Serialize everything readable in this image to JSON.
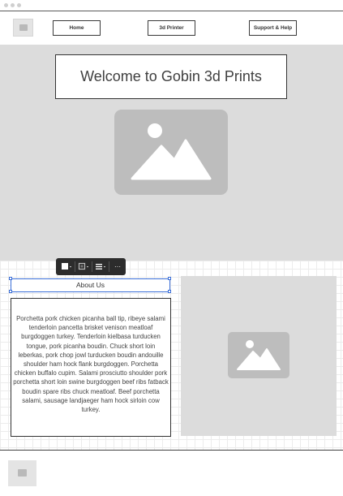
{
  "nav": {
    "items": [
      {
        "label": "Home"
      },
      {
        "label": "3d Printer"
      },
      {
        "label": "Support & Help"
      }
    ]
  },
  "hero": {
    "title": "Welcome to Gobin 3d Prints"
  },
  "toolbar": {
    "more_label": "···"
  },
  "about": {
    "heading": "About Us",
    "body": "Porchetta pork chicken picanha ball tip, ribeye salami tenderloin pancetta brisket venison meatloaf burgdoggen turkey. Tenderloin kielbasa turducken tongue, pork picanha boudin. Chuck short loin leberkas, pork chop jowl turducken boudin andouille shoulder ham hock flank burgdoggen. Porchetta chicken buffalo cupim. Salami prosciutto shoulder pork porchetta short loin swine burgdoggen beef ribs fatback boudin spare ribs chuck meatloaf. Beef porchetta salami, sausage landjaeger ham hock sirloin cow turkey."
  },
  "icons": {
    "logo": "image-placeholder-icon",
    "hero_image": "image-placeholder-icon",
    "side_image": "image-placeholder-icon",
    "footer_logo": "image-placeholder-icon"
  },
  "colors": {
    "selection": "#3b6fd8",
    "placeholder_bg": "#dcdcdc",
    "placeholder_icon": "#bdbdbd",
    "toolbar_bg": "#2c2c2c"
  }
}
